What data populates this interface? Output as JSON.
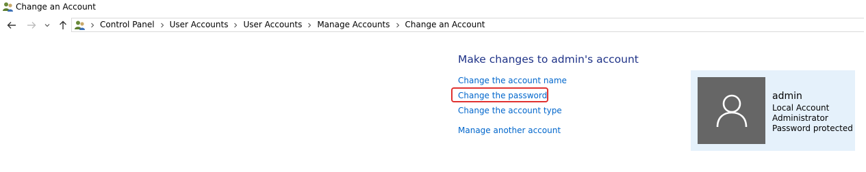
{
  "window": {
    "title": "Change an Account"
  },
  "navigation": {
    "back_icon": "arrow-left-icon",
    "forward_icon": "arrow-right-icon",
    "recent_icon": "chevron-down-icon",
    "up_icon": "arrow-up-icon"
  },
  "address_bar": {
    "icon": "user-accounts-icon",
    "breadcrumbs": [
      "Control Panel",
      "User Accounts",
      "User Accounts",
      "Manage Accounts",
      "Change an Account"
    ]
  },
  "main": {
    "heading": "Make changes to admin's account",
    "links": [
      "Change the account name",
      "Change the password",
      "Change the account type",
      "Manage another account"
    ],
    "highlighted_link": "Change the password"
  },
  "account": {
    "name": "admin",
    "details": [
      "Local Account",
      "Administrator",
      "Password protected"
    ]
  },
  "colors": {
    "link": "#0066cc",
    "heading": "#1e3287",
    "highlight": "#e0312f",
    "panel": "#e5f1fb",
    "avatar": "#666666"
  }
}
